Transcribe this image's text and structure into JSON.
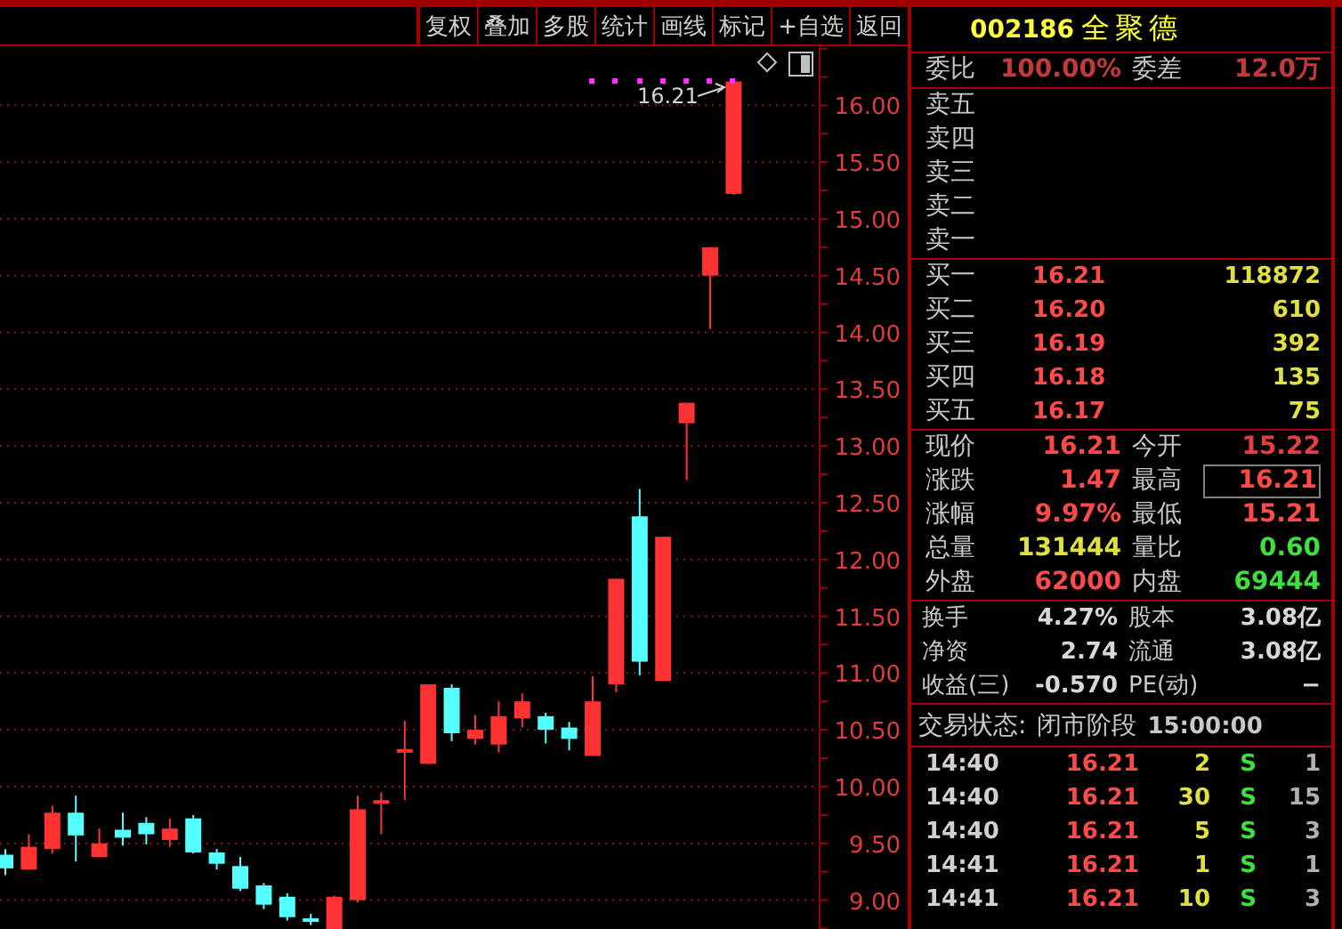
{
  "toolbar": {
    "buttons": [
      "复权",
      "叠加",
      "多股",
      "统计",
      "画线",
      "标记",
      "+自选",
      "返回"
    ]
  },
  "chart": {
    "last_price_marker": "16.21",
    "chart_data": {
      "type": "candlestick",
      "ylim": [
        8.73,
        16.52
      ],
      "grid": true,
      "ohlc": [
        [
          9.4,
          9.45,
          9.22,
          9.28
        ],
        [
          9.27,
          9.58,
          9.27,
          9.47
        ],
        [
          9.45,
          9.83,
          9.41,
          9.77
        ],
        [
          9.77,
          9.92,
          9.34,
          9.57
        ],
        [
          9.38,
          9.63,
          9.38,
          9.5
        ],
        [
          9.62,
          9.77,
          9.48,
          9.55
        ],
        [
          9.68,
          9.73,
          9.49,
          9.58
        ],
        [
          9.53,
          9.72,
          9.47,
          9.63
        ],
        [
          9.72,
          9.75,
          9.41,
          9.42
        ],
        [
          9.42,
          9.45,
          9.27,
          9.32
        ],
        [
          9.3,
          9.38,
          9.08,
          9.1
        ],
        [
          9.13,
          9.15,
          8.92,
          8.96
        ],
        [
          9.03,
          9.06,
          8.82,
          8.85
        ],
        [
          8.84,
          8.88,
          8.78,
          8.83
        ],
        [
          8.7,
          9.04,
          8.7,
          9.03
        ],
        [
          9.0,
          9.92,
          8.98,
          9.8
        ],
        [
          9.86,
          9.95,
          9.58,
          9.88
        ],
        [
          10.31,
          10.58,
          9.88,
          10.33
        ],
        [
          10.2,
          10.9,
          10.2,
          10.9
        ],
        [
          10.87,
          10.9,
          10.4,
          10.47
        ],
        [
          10.42,
          10.63,
          10.37,
          10.5
        ],
        [
          10.37,
          10.75,
          10.3,
          10.62
        ],
        [
          10.6,
          10.82,
          10.52,
          10.75
        ],
        [
          10.62,
          10.65,
          10.38,
          10.5
        ],
        [
          10.52,
          10.57,
          10.32,
          10.42
        ],
        [
          10.27,
          10.97,
          10.27,
          10.75
        ],
        [
          10.9,
          11.83,
          10.83,
          11.83
        ],
        [
          12.38,
          12.62,
          10.98,
          11.1
        ],
        [
          10.93,
          12.2,
          10.93,
          12.2
        ],
        [
          13.2,
          13.38,
          12.7,
          13.38
        ],
        [
          14.5,
          14.75,
          14.03,
          14.75
        ],
        [
          15.22,
          16.21,
          15.21,
          16.21
        ]
      ],
      "yticks": [
        {
          "value": 16,
          "label": "16.00"
        },
        {
          "value": 15.5,
          "label": "15.50"
        },
        {
          "value": 15,
          "label": "15.00"
        },
        {
          "value": 14.5,
          "label": "14.50"
        },
        {
          "value": 14,
          "label": "14.00"
        },
        {
          "value": 13.5,
          "label": "13.50"
        },
        {
          "value": 13,
          "label": "13.00"
        },
        {
          "value": 12.5,
          "label": "12.50"
        },
        {
          "value": 12,
          "label": "12.00"
        },
        {
          "value": 11.5,
          "label": "11.50"
        },
        {
          "value": 11,
          "label": "11.00"
        },
        {
          "value": 10.5,
          "label": "10.50"
        },
        {
          "value": 10,
          "label": "10.00"
        },
        {
          "value": 9.5,
          "label": "9.50"
        },
        {
          "value": 9,
          "label": "9.00"
        }
      ]
    }
  },
  "quote": {
    "code": "002186",
    "name": "全聚德",
    "order_ratio": [
      {
        "label": "委比",
        "value": "100.00%",
        "color": "#c43a3a"
      },
      {
        "label": "委差",
        "value": "12.0万",
        "color": "#c43a3a"
      }
    ],
    "asks": [
      {
        "label": "卖五"
      },
      {
        "label": "卖四"
      },
      {
        "label": "卖三"
      },
      {
        "label": "卖二"
      },
      {
        "label": "卖一"
      }
    ],
    "bids": [
      {
        "label": "买一",
        "price": "16.21",
        "volume": "118872"
      },
      {
        "label": "买二",
        "price": "16.20",
        "volume": "610"
      },
      {
        "label": "买三",
        "price": "16.19",
        "volume": "392"
      },
      {
        "label": "买四",
        "price": "16.18",
        "volume": "135"
      },
      {
        "label": "买五",
        "price": "16.17",
        "volume": "75"
      }
    ],
    "stats": [
      {
        "label": "现价",
        "value": "16.21",
        "color": "#ff4a4a",
        "boxed": false
      },
      {
        "label": "今开",
        "value": "15.22",
        "color": "#e04040",
        "boxed": false
      },
      {
        "label": "涨跌",
        "value": "1.47",
        "color": "#ff4a4a",
        "boxed": false
      },
      {
        "label": "最高",
        "value": "16.21",
        "color": "#ff4a4a",
        "boxed": true
      },
      {
        "label": "涨幅",
        "value": "9.97%",
        "color": "#ff4a4a",
        "boxed": false
      },
      {
        "label": "最低",
        "value": "15.21",
        "color": "#ff4a4a",
        "boxed": false
      },
      {
        "label": "总量",
        "value": "131444",
        "color": "#e0e040",
        "boxed": false
      },
      {
        "label": "量比",
        "value": "0.60",
        "color": "#3ee03e",
        "boxed": false
      },
      {
        "label": "外盘",
        "value": "62000",
        "color": "#ff4a4a",
        "boxed": false
      },
      {
        "label": "内盘",
        "value": "69444",
        "color": "#3ee03e",
        "boxed": false
      }
    ],
    "fundamentals": [
      {
        "label": "换手",
        "value": "4.27%"
      },
      {
        "label": "股本",
        "value": "3.08亿"
      },
      {
        "label": "净资",
        "value": "2.74"
      },
      {
        "label": "流通",
        "value": "3.08亿"
      },
      {
        "label": "收益(三)",
        "value": "-0.570"
      },
      {
        "label": "PE(动)",
        "value": "−"
      }
    ],
    "trading_status": {
      "label": "交易状态:",
      "value": "闭市阶段",
      "time": "15:00:00"
    },
    "ticks": [
      {
        "time": "14:40",
        "price": "16.21",
        "volume": "2",
        "side": "S",
        "count": "1"
      },
      {
        "time": "14:40",
        "price": "16.21",
        "volume": "30",
        "side": "S",
        "count": "15"
      },
      {
        "time": "14:40",
        "price": "16.21",
        "volume": "5",
        "side": "S",
        "count": "3"
      },
      {
        "time": "14:41",
        "price": "16.21",
        "volume": "1",
        "side": "S",
        "count": "1"
      },
      {
        "time": "14:41",
        "price": "16.21",
        "volume": "10",
        "side": "S",
        "count": "3"
      }
    ]
  }
}
